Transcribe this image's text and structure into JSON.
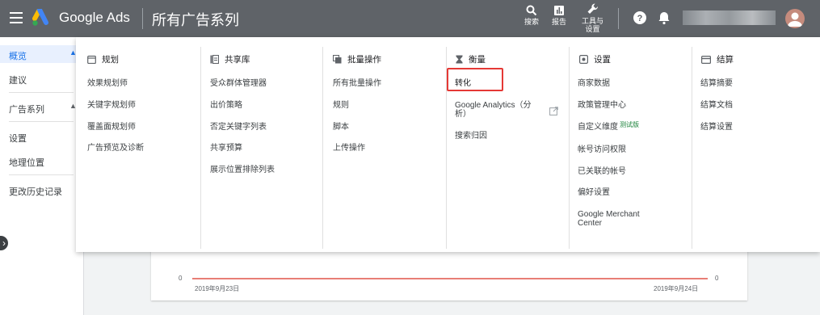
{
  "topbar": {
    "brand": "Google Ads",
    "page_title": "所有广告系列",
    "search_label": "搜索",
    "reports_label": "报告",
    "tools_label_1": "工具与",
    "tools_label_2": "设置",
    "colors": {
      "bar": "#5f6368"
    }
  },
  "leftnav": {
    "items": [
      {
        "label": "概览"
      },
      {
        "label": "建议"
      },
      {
        "label": "广告系列"
      },
      {
        "label": "设置"
      },
      {
        "label": "地理位置"
      },
      {
        "label": "更改历史记录"
      }
    ]
  },
  "chart": {
    "y_left": "0",
    "y_right": "0",
    "x_start": "2019年9月23日",
    "x_end": "2019年9月24日"
  },
  "menu": {
    "columns": [
      {
        "icon": "calendar-icon",
        "title": "规划",
        "items": [
          "效果规划师",
          "关键字规划师",
          "覆盖面规划师",
          "广告预览及诊断"
        ]
      },
      {
        "icon": "library-icon",
        "title": "共享库",
        "items": [
          "受众群体管理器",
          "出价策略",
          "否定关键字列表",
          "共享预算",
          "展示位置排除列表"
        ]
      },
      {
        "icon": "copy-icon",
        "title": "批量操作",
        "items": [
          "所有批量操作",
          "规则",
          "脚本",
          "上传操作"
        ]
      },
      {
        "icon": "hourglass-icon",
        "title": "衡量",
        "items": [
          "转化",
          "Google Analytics（分析）",
          "搜索归因"
        ]
      },
      {
        "icon": "gear-icon",
        "title": "设置",
        "items": [
          "商家数据",
          "政策管理中心",
          "自定义维度",
          "帐号访问权限",
          "已关联的帐号",
          "偏好设置",
          "Google Merchant Center"
        ],
        "beta_label": "测试版"
      },
      {
        "icon": "card-icon",
        "title": "结算",
        "items": [
          "结算摘要",
          "结算文档",
          "结算设置"
        ]
      }
    ],
    "analytics_line1": "Google Analytics（分",
    "analytics_line2": "析）",
    "merchant_line1": "Google Merchant",
    "merchant_line2": "Center"
  },
  "colors": {
    "highlight": "#e53935",
    "accent": "#1a73e8",
    "chart_line": "#d93025"
  }
}
